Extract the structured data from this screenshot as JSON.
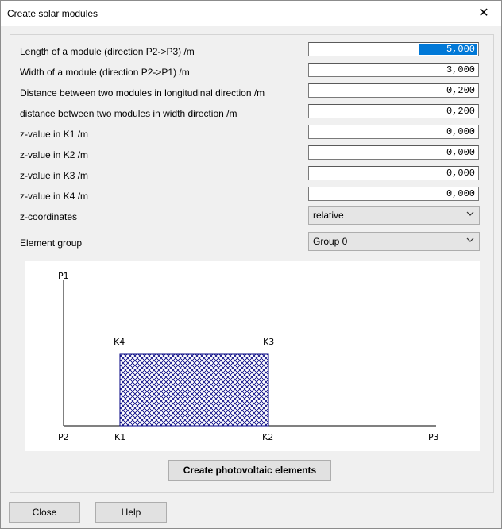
{
  "window": {
    "title": "Create solar modules",
    "close_glyph": "✕"
  },
  "fields": [
    {
      "label": "Length of a module (direction P2->P3) /m",
      "value": "5,000",
      "selected": true
    },
    {
      "label": "Width of a module (direction P2->P1) /m",
      "value": "3,000"
    },
    {
      "label": "Distance between two modules in longitudinal direction /m",
      "value": "0,200"
    },
    {
      "label": "distance between two modules in width direction /m",
      "value": "0,200"
    },
    {
      "label": "z-value in K1 /m",
      "value": "0,000"
    },
    {
      "label": "z-value in K2 /m",
      "value": "0,000"
    },
    {
      "label": "z-value in K3 /m",
      "value": "0,000"
    },
    {
      "label": "z-value in K4 /m",
      "value": "0,000"
    }
  ],
  "zcoords": {
    "label": "z-coordinates",
    "value": "relative"
  },
  "element_group": {
    "label": "Element group",
    "value": "Group 0"
  },
  "diagram": {
    "labels": {
      "p1": "P1",
      "p2": "P2",
      "p3": "P3",
      "k1": "K1",
      "k2": "K2",
      "k3": "K3",
      "k4": "K4"
    },
    "module_color": "#000080"
  },
  "buttons": {
    "create": "Create photovoltaic elements",
    "close": "Close",
    "help": "Help"
  }
}
